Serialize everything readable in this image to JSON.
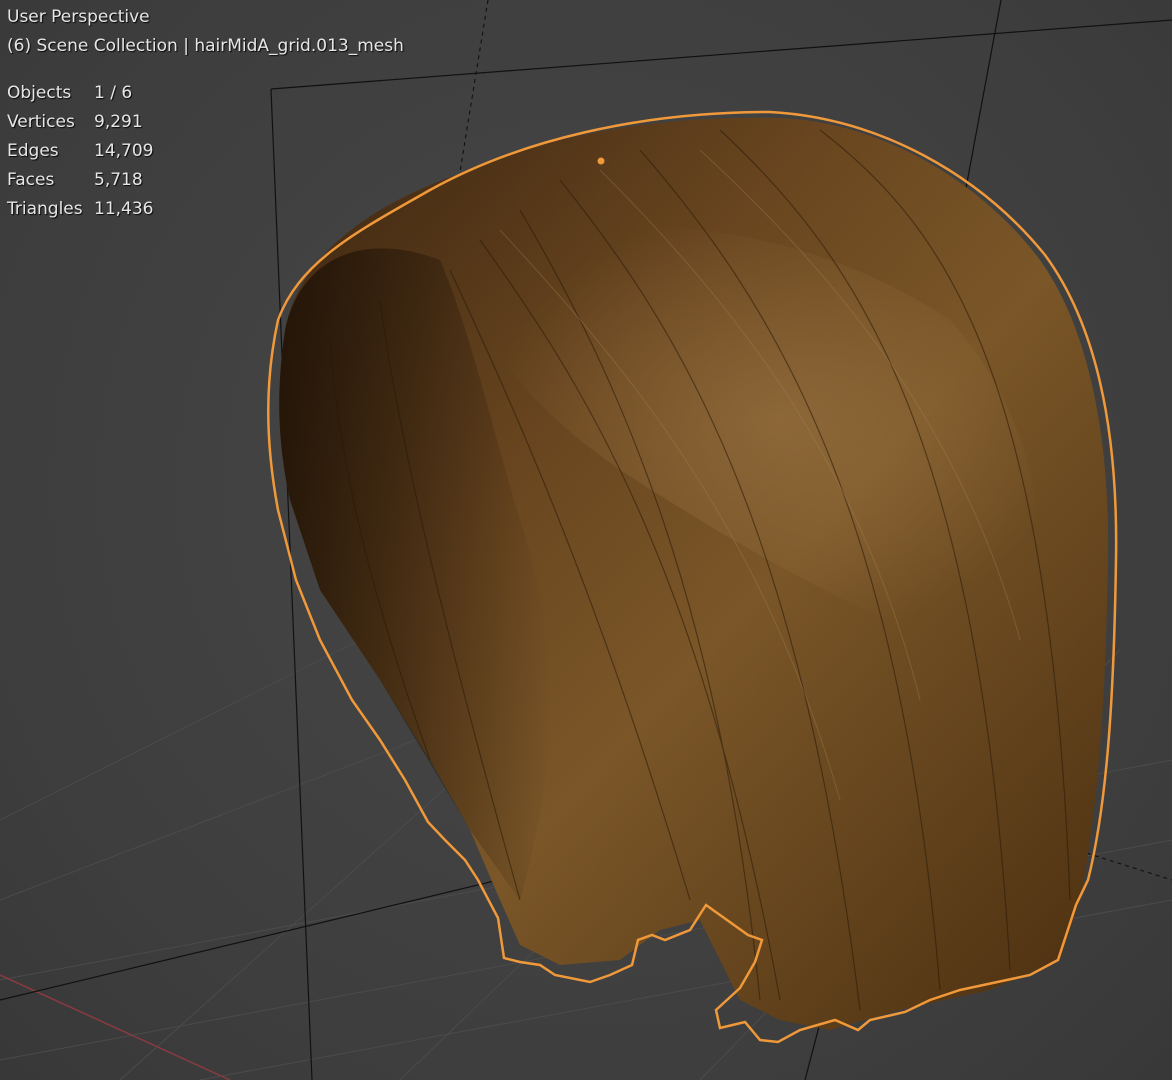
{
  "viewport": {
    "title": "User Perspective",
    "subtitle": "(6) Scene Collection | hairMidA_grid.013_mesh",
    "colors": {
      "background": "#3d3d3d",
      "grid_line": "#4a4a4a",
      "camera_line": "#111111",
      "x_axis": "#8a3a42",
      "selection_outline": "#f0993a",
      "hair_base": "#5a3a14",
      "hair_highlight": "#8b6a3c",
      "hair_shadow": "#2b1a08"
    }
  },
  "stats": [
    {
      "label": "Objects",
      "value": "1 / 6"
    },
    {
      "label": "Vertices",
      "value": "9,291"
    },
    {
      "label": "Edges",
      "value": "14,709"
    },
    {
      "label": "Faces",
      "value": "5,718"
    },
    {
      "label": "Triangles",
      "value": "11,436"
    }
  ],
  "selected_object": {
    "name": "hairMidA_grid.013_mesh",
    "icon": "hair-mesh"
  }
}
